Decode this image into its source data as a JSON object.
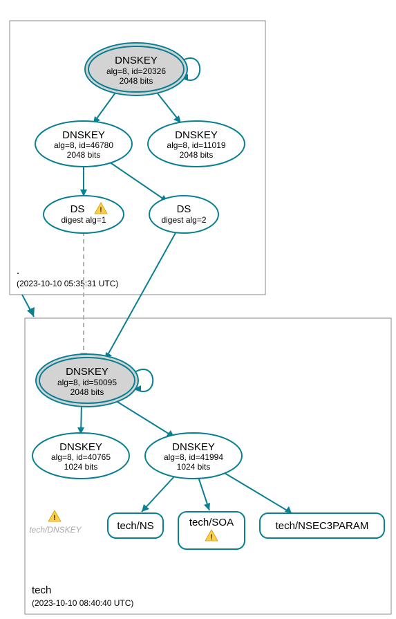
{
  "zones": {
    "root": {
      "label": ".",
      "timestamp": "(2023-10-10 05:35:31 UTC)"
    },
    "tech": {
      "label": "tech",
      "timestamp": "(2023-10-10 08:40:40 UTC)"
    }
  },
  "nodes": {
    "root_ksk": {
      "title": "DNSKEY",
      "line2": "alg=8, id=20326",
      "line3": "2048 bits"
    },
    "root_dkey_l": {
      "title": "DNSKEY",
      "line2": "alg=8, id=46780",
      "line3": "2048 bits"
    },
    "root_dkey_r": {
      "title": "DNSKEY",
      "line2": "alg=8, id=11019",
      "line3": "2048 bits"
    },
    "ds_l": {
      "title": "DS",
      "line2": "digest alg=1"
    },
    "ds_r": {
      "title": "DS",
      "line2": "digest alg=2"
    },
    "tech_ksk": {
      "title": "DNSKEY",
      "line2": "alg=8, id=50095",
      "line3": "2048 bits"
    },
    "tech_dkey_l": {
      "title": "DNSKEY",
      "line2": "alg=8, id=40765",
      "line3": "1024 bits"
    },
    "tech_dkey_r": {
      "title": "DNSKEY",
      "line2": "alg=8, id=41994",
      "line3": "1024 bits"
    },
    "tech_dnskey_dim": {
      "label": "tech/DNSKEY"
    },
    "tech_ns": {
      "label": "tech/NS"
    },
    "tech_soa": {
      "label": "tech/SOA"
    },
    "tech_nsec3": {
      "label": "tech/NSEC3PARAM"
    }
  },
  "chart_data": {
    "type": "graph",
    "zones": [
      {
        "name": ".",
        "timestamp": "2023-10-10 05:35:31 UTC"
      },
      {
        "name": "tech",
        "timestamp": "2023-10-10 08:40:40 UTC"
      }
    ],
    "nodes": [
      {
        "id": "root_ksk",
        "zone": ".",
        "type": "DNSKEY",
        "alg": 8,
        "key_id": 20326,
        "bits": 2048,
        "ksk": true,
        "self_signed": true,
        "warning": false
      },
      {
        "id": "root_zsk_l",
        "zone": ".",
        "type": "DNSKEY",
        "alg": 8,
        "key_id": 46780,
        "bits": 2048,
        "ksk": false,
        "self_signed": false,
        "warning": false
      },
      {
        "id": "root_zsk_r",
        "zone": ".",
        "type": "DNSKEY",
        "alg": 8,
        "key_id": 11019,
        "bits": 2048,
        "ksk": false,
        "self_signed": false,
        "warning": false
      },
      {
        "id": "ds1",
        "zone": ".",
        "type": "DS",
        "digest_alg": 1,
        "warning": true
      },
      {
        "id": "ds2",
        "zone": ".",
        "type": "DS",
        "digest_alg": 2,
        "warning": false
      },
      {
        "id": "tech_ksk",
        "zone": "tech",
        "type": "DNSKEY",
        "alg": 8,
        "key_id": 50095,
        "bits": 2048,
        "ksk": true,
        "self_signed": true,
        "warning": false
      },
      {
        "id": "tech_zsk_l",
        "zone": "tech",
        "type": "DNSKEY",
        "alg": 8,
        "key_id": 40765,
        "bits": 1024,
        "ksk": false,
        "self_signed": false,
        "warning": false
      },
      {
        "id": "tech_zsk_r",
        "zone": "tech",
        "type": "DNSKEY",
        "alg": 8,
        "key_id": 41994,
        "bits": 1024,
        "ksk": false,
        "self_signed": false,
        "warning": false
      },
      {
        "id": "tech_dnskey",
        "zone": "tech",
        "type": "RRset",
        "name": "tech/DNSKEY",
        "warning": true,
        "dimmed": true
      },
      {
        "id": "tech_ns",
        "zone": "tech",
        "type": "RRset",
        "name": "tech/NS"
      },
      {
        "id": "tech_soa",
        "zone": "tech",
        "type": "RRset",
        "name": "tech/SOA",
        "warning": true
      },
      {
        "id": "tech_nsec3",
        "zone": "tech",
        "type": "RRset",
        "name": "tech/NSEC3PARAM"
      }
    ],
    "edges": [
      {
        "from": "root_ksk",
        "to": "root_ksk",
        "style": "self"
      },
      {
        "from": "root_ksk",
        "to": "root_zsk_l",
        "style": "solid"
      },
      {
        "from": "root_ksk",
        "to": "root_zsk_r",
        "style": "solid"
      },
      {
        "from": "root_zsk_l",
        "to": "ds1",
        "style": "solid"
      },
      {
        "from": "root_zsk_l",
        "to": "ds2",
        "style": "solid"
      },
      {
        "from": "ds1",
        "to": "tech_ksk",
        "style": "dashed"
      },
      {
        "from": "ds2",
        "to": "tech_ksk",
        "style": "solid"
      },
      {
        "from": "tech_ksk",
        "to": "tech_ksk",
        "style": "self"
      },
      {
        "from": "tech_ksk",
        "to": "tech_zsk_l",
        "style": "solid"
      },
      {
        "from": "tech_ksk",
        "to": "tech_zsk_r",
        "style": "solid"
      },
      {
        "from": "tech_zsk_r",
        "to": "tech_ns",
        "style": "solid"
      },
      {
        "from": "tech_zsk_r",
        "to": "tech_soa",
        "style": "solid"
      },
      {
        "from": "tech_zsk_r",
        "to": "tech_nsec3",
        "style": "solid"
      },
      {
        "from": "zone_root",
        "to": "zone_tech",
        "style": "zone_delegation"
      }
    ]
  }
}
